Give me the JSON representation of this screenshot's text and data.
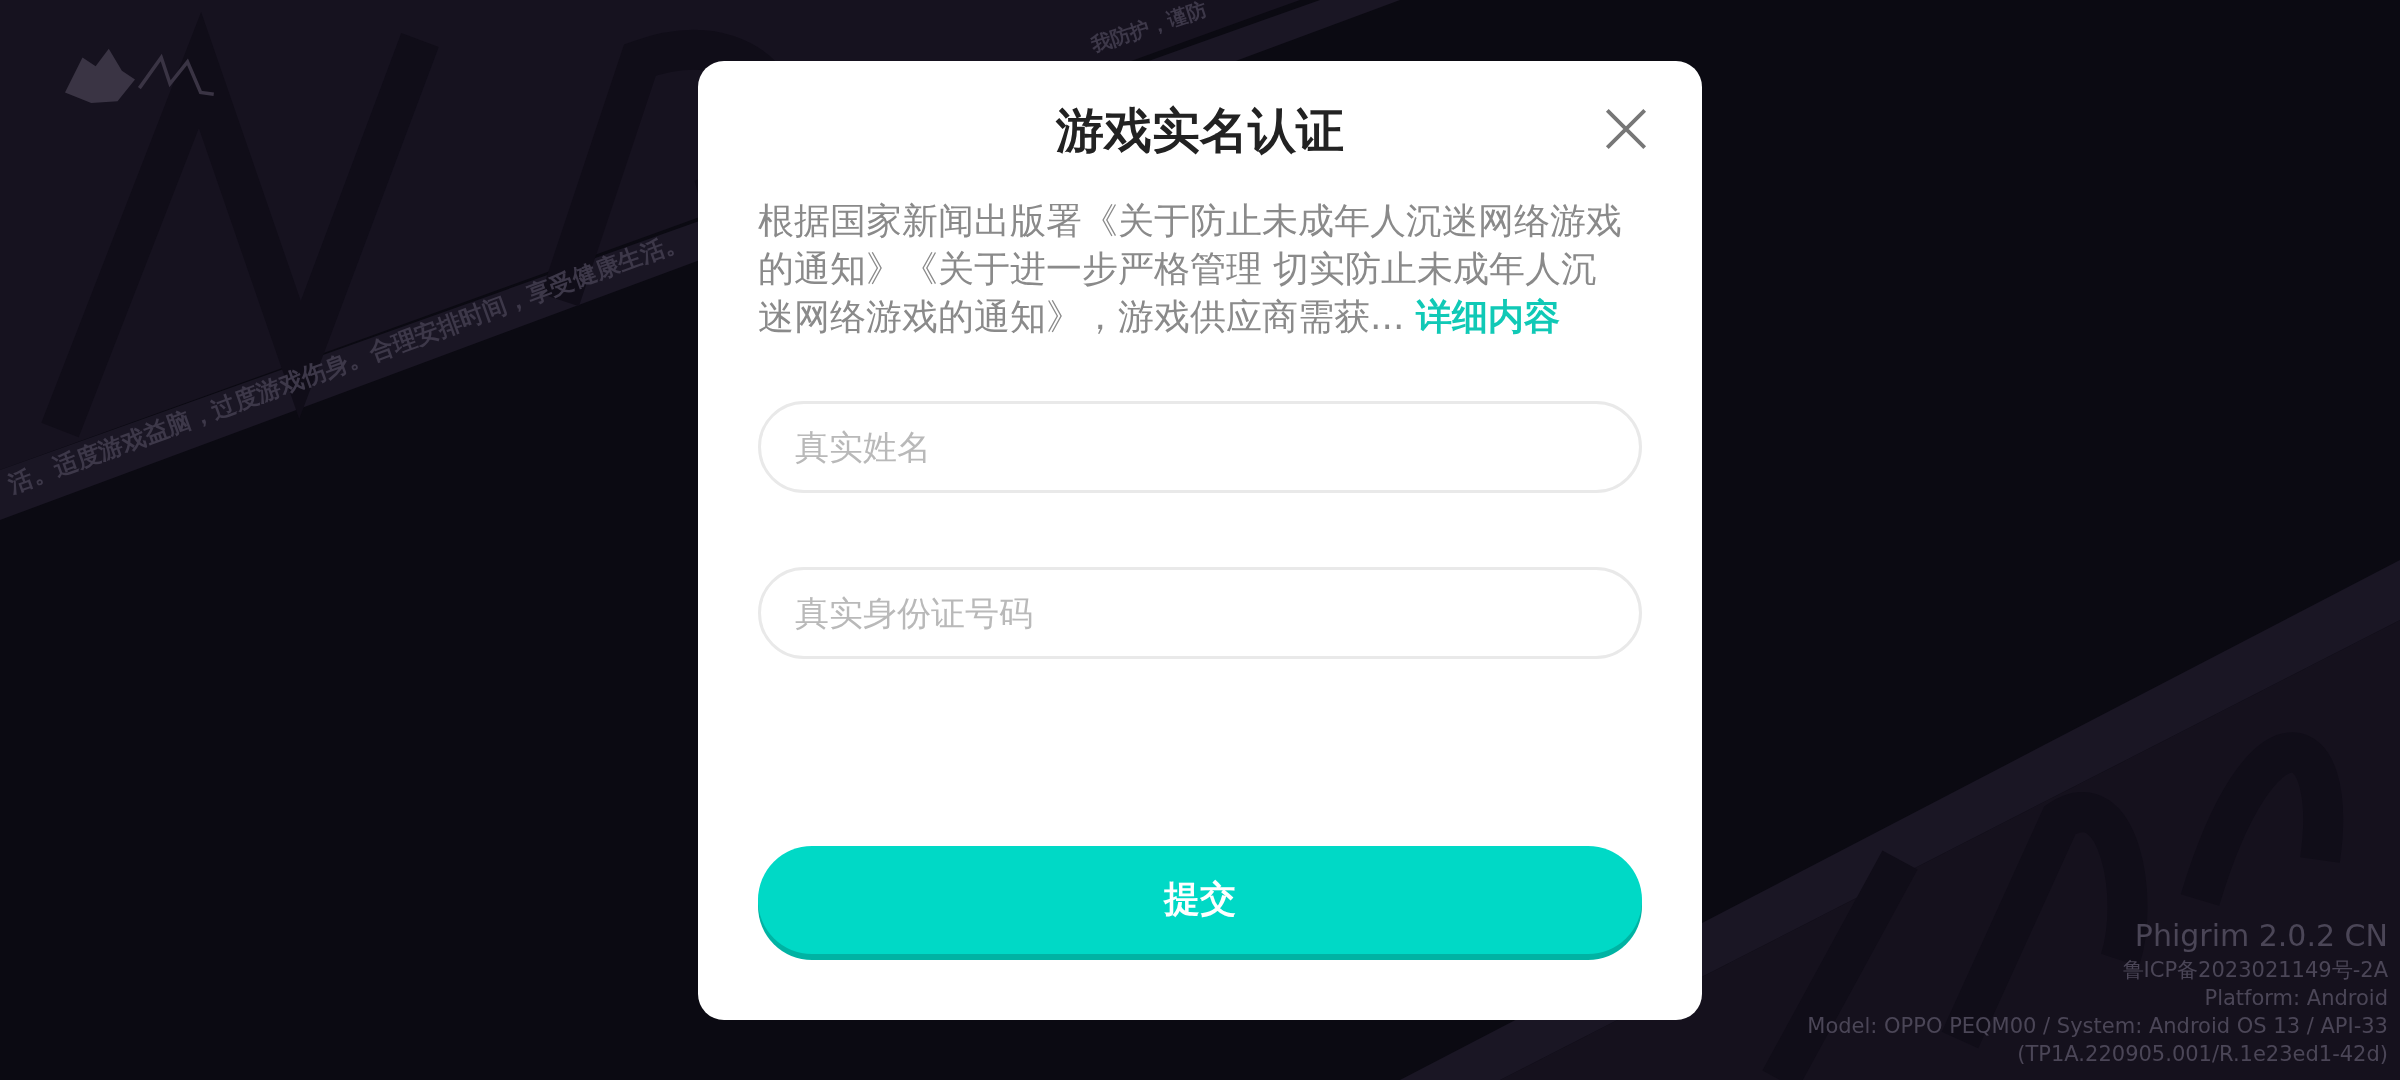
{
  "background": {
    "slogans": [
      {
        "text": "活。适度游戏益脑，过度游戏伤身。合理安排时间，享受健康生活。"
      },
      {
        "text": "我防护，谨防"
      }
    ]
  },
  "dialog": {
    "title": "游戏实名认证",
    "notice": {
      "text": "根据国家新闻出版署《关于防止未成年人沉迷网络游戏的通知》《关于进一步严格管理 切实防止未成年人沉迷网络游戏的通知》，游戏供应商需获...",
      "link": "详细内容"
    },
    "fields": [
      {
        "placeholder": "真实姓名"
      },
      {
        "placeholder": "真实身份证号码"
      }
    ],
    "submit": "提交"
  },
  "footer": {
    "version": "Phigrim 2.0.2 CN",
    "lines": [
      "鲁ICP备2023021149号-2A",
      "Platform: Android",
      "Model: OPPO PEQM00 / System: Android OS 13 / API-33",
      "(TP1A.220905.001/R.1e23ed1-42d)"
    ]
  }
}
